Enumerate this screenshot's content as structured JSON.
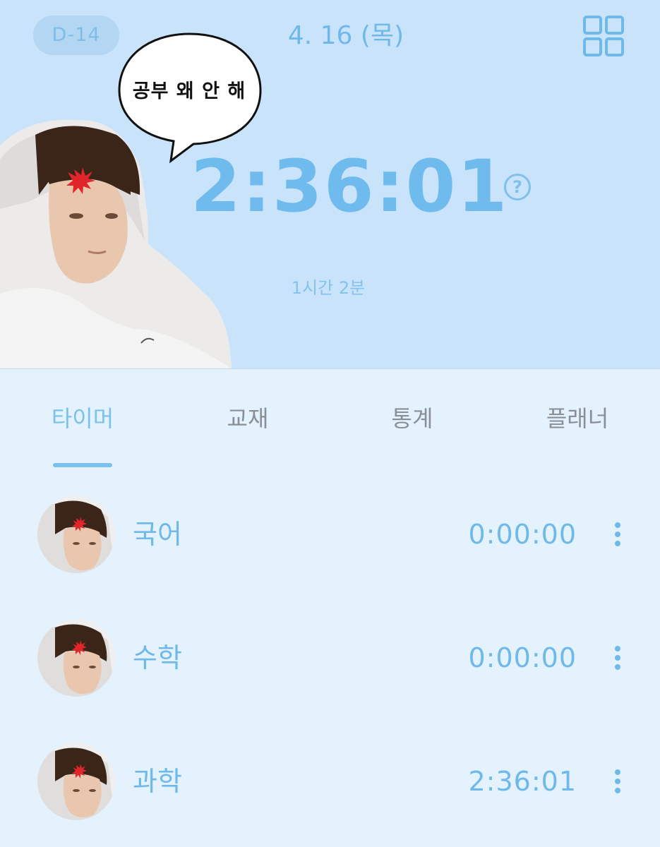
{
  "header": {
    "dday": "D-14",
    "date": "4. 16 (목)",
    "timer": "2:36:01",
    "sub_time": "1시간 2분",
    "speech_bubble": "공부 왜 안 해"
  },
  "tabs": [
    {
      "label": "타이머",
      "active": true
    },
    {
      "label": "교재",
      "active": false
    },
    {
      "label": "통계",
      "active": false
    },
    {
      "label": "플래너",
      "active": false
    }
  ],
  "subjects": [
    {
      "name": "국어",
      "time": "0:00:00"
    },
    {
      "name": "수학",
      "time": "0:00:00"
    },
    {
      "name": "과학",
      "time": "2:36:01"
    }
  ],
  "icons": {
    "menu": "grid-icon",
    "help": "help-icon",
    "more": "more-vertical-icon"
  },
  "colors": {
    "header_bg": "#c9e4fa",
    "body_bg": "#e3f2fd",
    "accent": "#6fb9ea",
    "inactive_tab": "#8a8f96"
  }
}
